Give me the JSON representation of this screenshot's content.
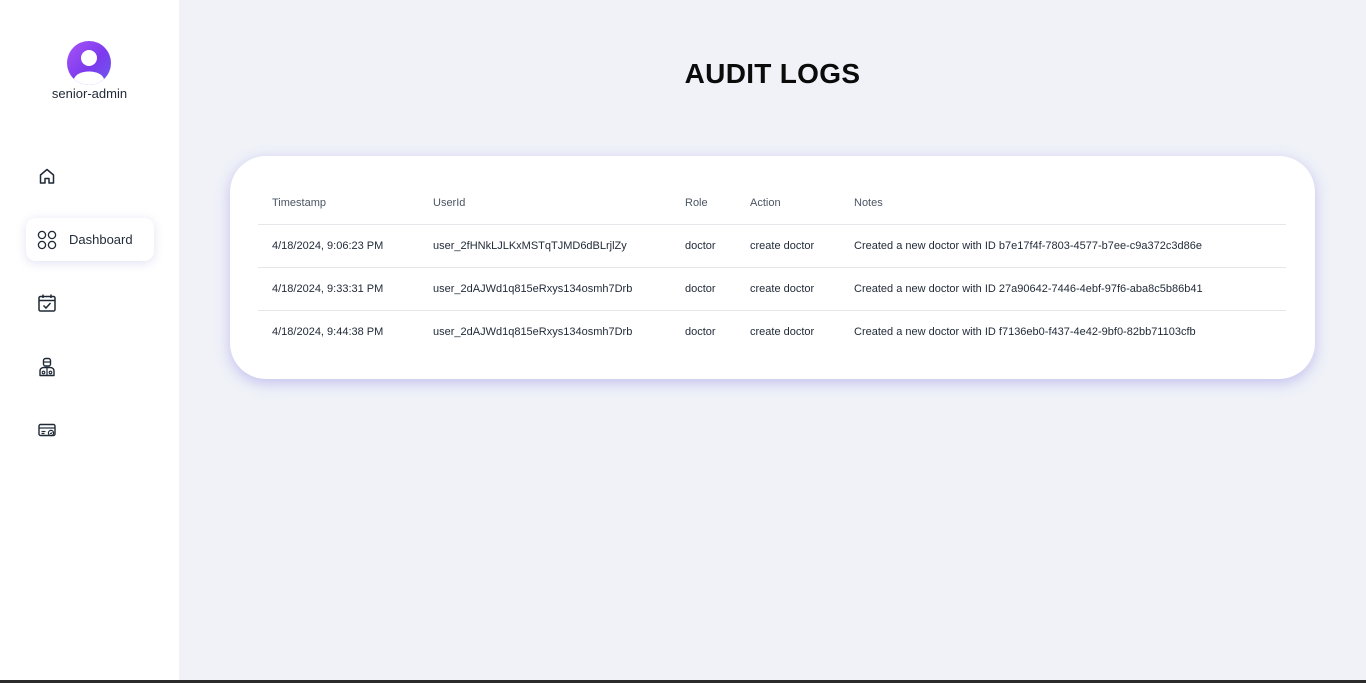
{
  "user": {
    "name": "senior-admin"
  },
  "sidebar": {
    "items": [
      {
        "icon": "home-icon",
        "label": ""
      },
      {
        "icon": "dashboard-grid-icon",
        "label": "Dashboard"
      },
      {
        "icon": "calendar-check-icon",
        "label": ""
      },
      {
        "icon": "doctor-icon",
        "label": ""
      },
      {
        "icon": "billing-card-icon",
        "label": ""
      }
    ]
  },
  "page": {
    "title": "AUDIT LOGS"
  },
  "table": {
    "headers": [
      "Timestamp",
      "UserId",
      "Role",
      "Action",
      "Notes"
    ],
    "rows": [
      [
        "4/18/2024, 9:06:23 PM",
        "user_2fHNkLJLKxMSTqTJMD6dBLrjlZy",
        "doctor",
        "create doctor",
        "Created a new doctor with ID b7e17f4f-7803-4577-b7ee-c9a372c3d86e"
      ],
      [
        "4/18/2024, 9:33:31 PM",
        "user_2dAJWd1q815eRxys134osmh7Drb",
        "doctor",
        "create doctor",
        "Created a new doctor with ID 27a90642-7446-4ebf-97f6-aba8c5b86b41"
      ],
      [
        "4/18/2024, 9:44:38 PM",
        "user_2dAJWd1q815eRxys134osmh7Drb",
        "doctor",
        "create doctor",
        "Created a new doctor with ID f7136eb0-f437-4e42-9bf0-82bb71103cfb"
      ]
    ]
  },
  "colors": {
    "accent_start": "#a855f7",
    "accent_end": "#6d5bf0",
    "background": "#f0f2f8"
  }
}
